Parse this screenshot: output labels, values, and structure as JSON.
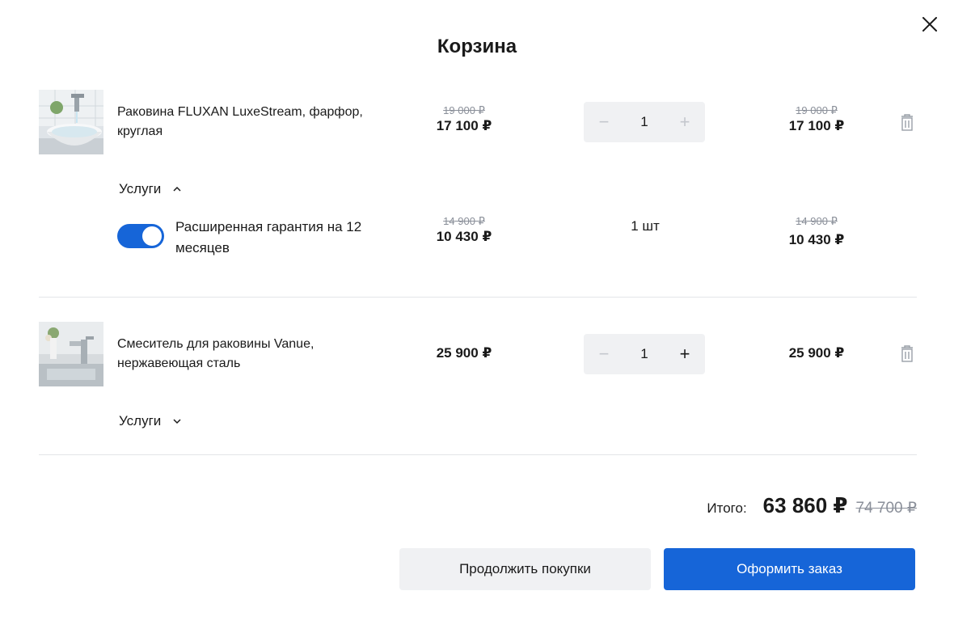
{
  "dialog": {
    "title": "Корзина",
    "close_icon": "close-icon"
  },
  "items": [
    {
      "name": "Раковина FLUXAN LuxeStream, фарфор, круглая",
      "thumbnail": "sink-bowl-image",
      "unit_price_old": "19 000 ₽",
      "unit_price": "17 100 ₽",
      "quantity": "1",
      "total_old": "19 000 ₽",
      "total": "17 100 ₽",
      "services_label": "Услуги",
      "services_expanded": true,
      "plus_enabled": false,
      "service": {
        "enabled": true,
        "name": "Расширенная гарантия на 12 месяцев",
        "price_old": "14 900 ₽",
        "price": "10 430 ₽",
        "quantity": "1 шт",
        "total_old": "14 900 ₽",
        "total": "10 430 ₽"
      }
    },
    {
      "name": "Смеситель для раковины Vanue, нержавеющая сталь",
      "thumbnail": "faucet-image",
      "unit_price": "25 900 ₽",
      "quantity": "1",
      "total": "25 900 ₽",
      "services_label": "Услуги",
      "services_expanded": false,
      "plus_enabled": true
    }
  ],
  "summary": {
    "label": "Итого:",
    "total": "63 860 ₽",
    "total_old": "74 700 ₽"
  },
  "actions": {
    "continue_label": "Продолжить покупки",
    "order_label": "Оформить заказ"
  },
  "colors": {
    "accent": "#1665d8",
    "muted": "#8a8f99",
    "surface": "#f0f1f3"
  }
}
